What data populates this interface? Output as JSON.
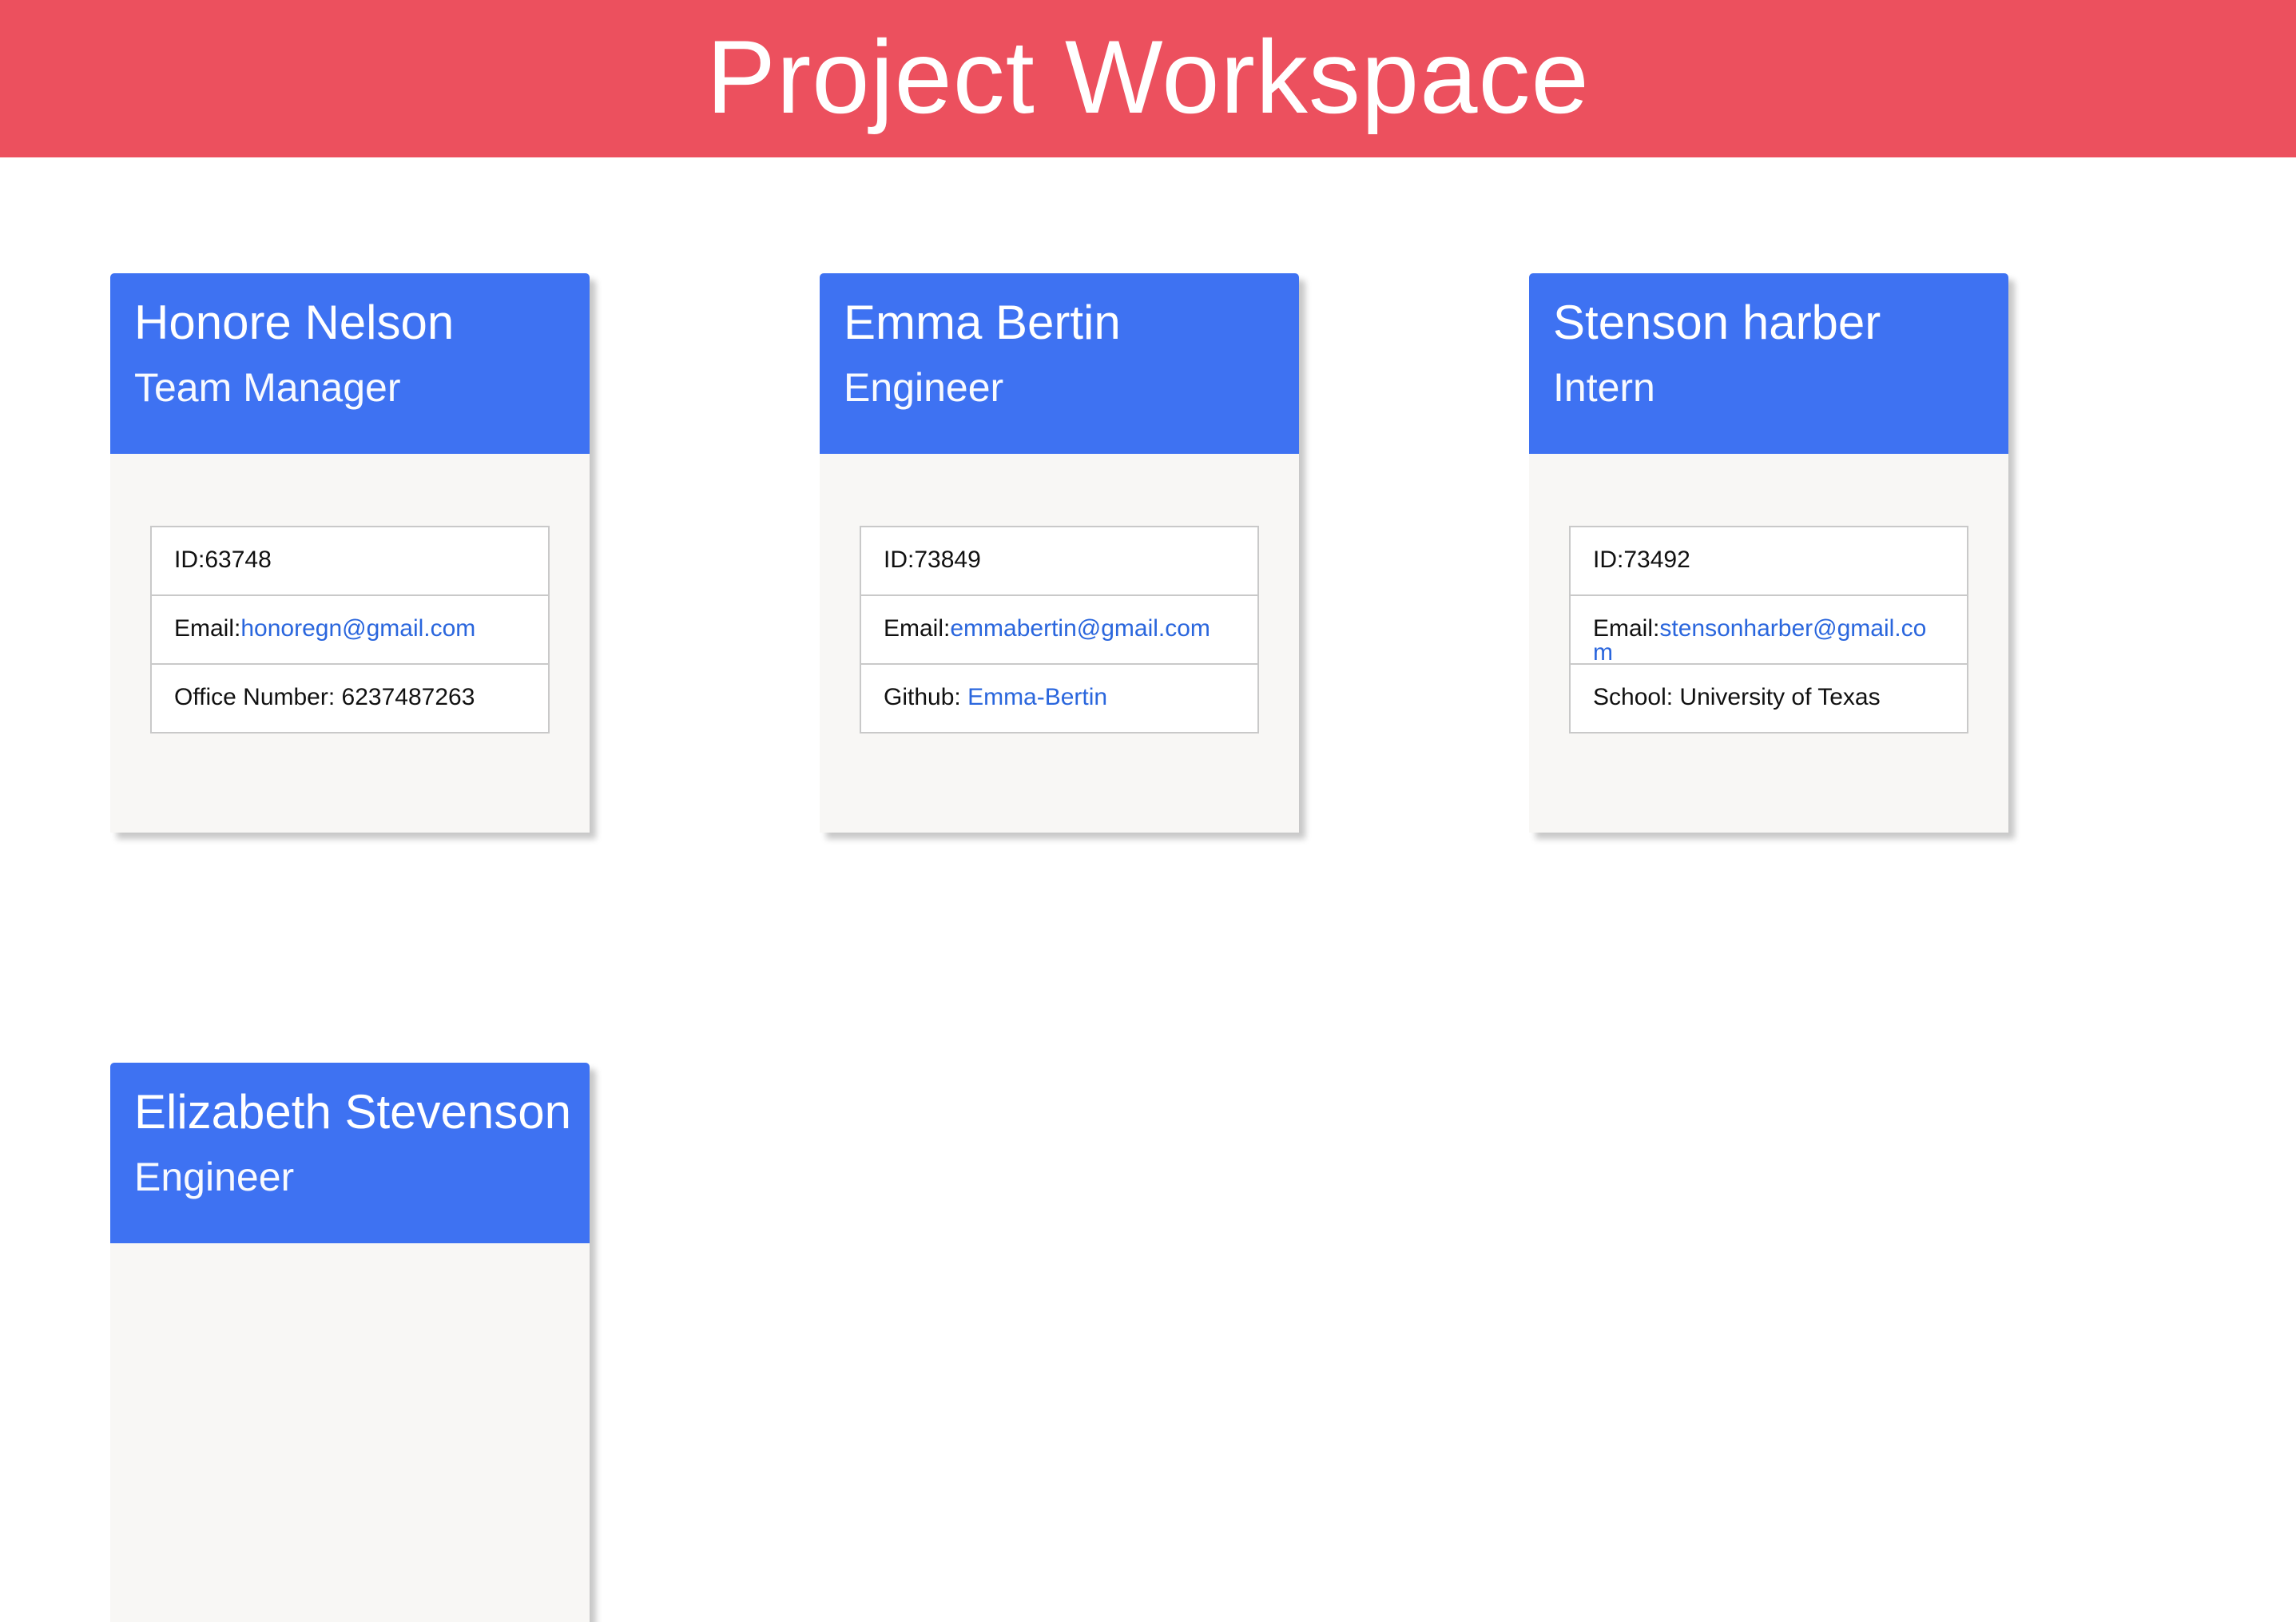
{
  "header": {
    "title": "Project Workspace"
  },
  "colors": {
    "header_bg": "#ec505e",
    "card_head_bg": "#3e72f2",
    "link": "#2a66dd"
  },
  "cards": [
    {
      "name": "Honore Nelson",
      "role": "Team Manager",
      "id_label": "ID:",
      "id": "63748",
      "email_label": "Email:",
      "email": "honoregn@gmail.com",
      "extra_label": "Office Number: ",
      "extra_value": "6237487263"
    },
    {
      "name": "Emma Bertin",
      "role": "Engineer",
      "id_label": "ID:",
      "id": "73849",
      "email_label": "Email:",
      "email": "emmabertin@gmail.com",
      "extra_label": "Github: ",
      "extra_value": "Emma-Bertin"
    },
    {
      "name": "Stenson harber",
      "role": "Intern",
      "id_label": "ID:",
      "id": "73492",
      "email_label": "Email:",
      "email": "stensonharber@gmail.com",
      "extra_label": "School: ",
      "extra_value": "University of Texas"
    },
    {
      "name": "Elizabeth Stevenson",
      "role": "Engineer"
    }
  ]
}
